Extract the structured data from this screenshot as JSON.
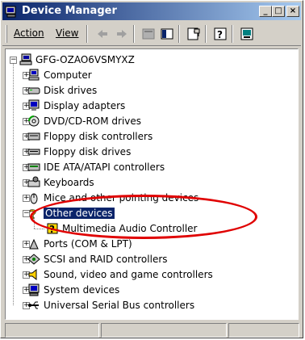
{
  "window": {
    "title": "Device Manager"
  },
  "caption_buttons": {
    "minimize": "_",
    "maximize": "□",
    "close": "×"
  },
  "menu": {
    "action": "Action",
    "view": "View"
  },
  "toolbar_icons": [
    "back-icon",
    "forward-icon",
    "up-icon",
    "properties-icon",
    "scan-icon",
    "help-icon",
    "monitor-icon"
  ],
  "tree": {
    "root": "GFG-OZAO6VSMYXZ",
    "items": [
      {
        "label": "Computer",
        "icon": "computer-icon"
      },
      {
        "label": "Disk drives",
        "icon": "disk-icon"
      },
      {
        "label": "Display adapters",
        "icon": "display-icon"
      },
      {
        "label": "DVD/CD-ROM drives",
        "icon": "cdrom-icon"
      },
      {
        "label": "Floppy disk controllers",
        "icon": "floppy-controller-icon"
      },
      {
        "label": "Floppy disk drives",
        "icon": "floppy-drive-icon"
      },
      {
        "label": "IDE ATA/ATAPI controllers",
        "icon": "ide-icon"
      },
      {
        "label": "Keyboards",
        "icon": "keyboard-icon"
      },
      {
        "label": "Mice and other pointing devices",
        "icon": "mouse-icon"
      },
      {
        "label": "Other devices",
        "icon": "unknown-device-icon",
        "expanded": true,
        "selected": true
      },
      {
        "label": "Multimedia Audio Controller",
        "icon": "warning-device-icon",
        "child": true
      },
      {
        "label": "Ports (COM & LPT)",
        "icon": "port-icon"
      },
      {
        "label": "SCSI and RAID controllers",
        "icon": "scsi-icon"
      },
      {
        "label": "Sound, video and game controllers",
        "icon": "sound-icon"
      },
      {
        "label": "System devices",
        "icon": "system-icon"
      },
      {
        "label": "Universal Serial Bus controllers",
        "icon": "usb-icon"
      }
    ]
  },
  "colors": {
    "titlebar": "#0a246a",
    "selection": "#0a246a",
    "highlight_ellipse": "#e00000"
  }
}
